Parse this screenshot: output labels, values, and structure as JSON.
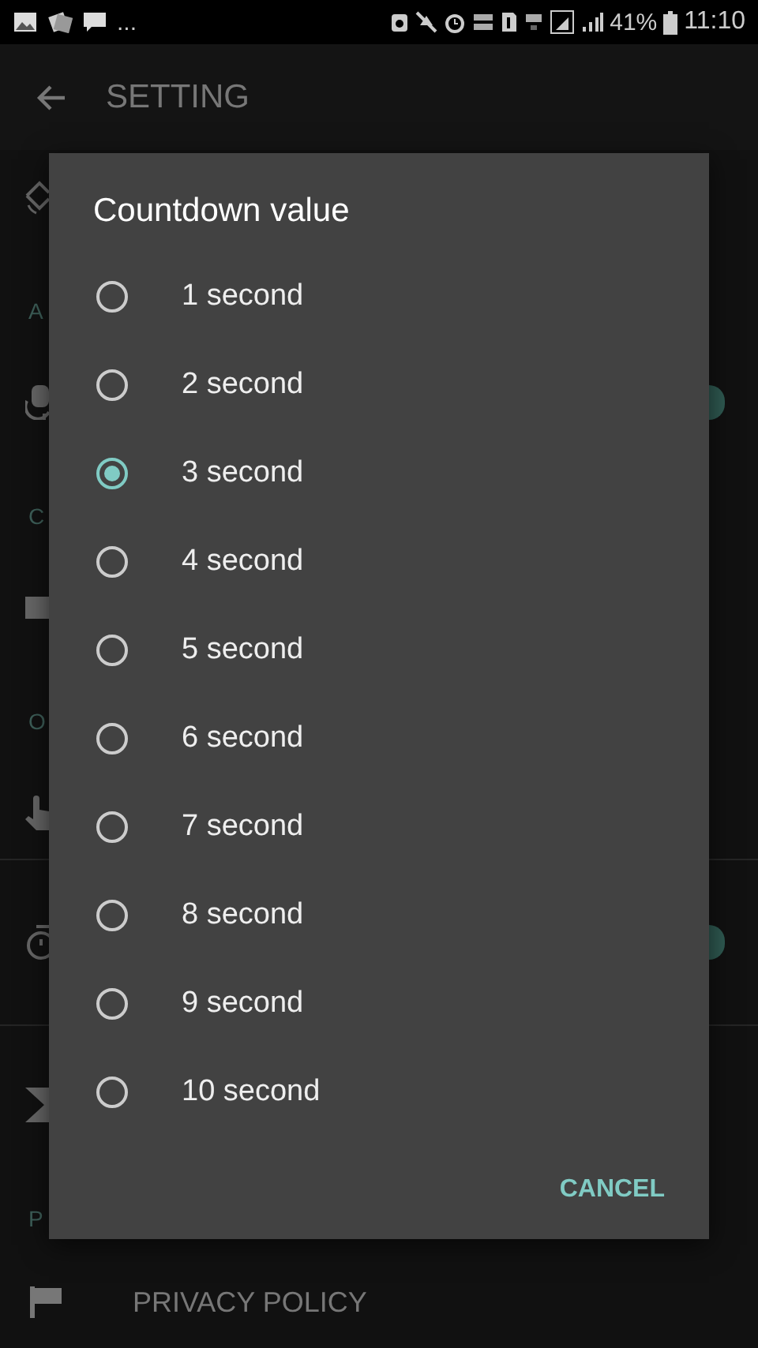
{
  "status_bar": {
    "overflow": "...",
    "battery": "41%",
    "time": "11:10"
  },
  "app_bar": {
    "title": "SETTING"
  },
  "settings": [
    {
      "kind": "row"
    },
    {
      "kind": "header",
      "label": "A"
    },
    {
      "kind": "row",
      "toggle_on": true
    },
    {
      "kind": "header",
      "label": "C"
    },
    {
      "kind": "row"
    },
    {
      "kind": "header",
      "label": "O"
    },
    {
      "kind": "row",
      "divider": true
    },
    {
      "kind": "row",
      "toggle_on": true,
      "divider": true
    },
    {
      "kind": "row"
    },
    {
      "kind": "header",
      "label": "P"
    },
    {
      "kind": "row",
      "label": "PRIVACY POLICY"
    }
  ],
  "dialog": {
    "title": "Countdown value",
    "options": [
      {
        "label": "1 second",
        "selected": false
      },
      {
        "label": "2 second",
        "selected": false
      },
      {
        "label": "3 second",
        "selected": true
      },
      {
        "label": "4 second",
        "selected": false
      },
      {
        "label": "5 second",
        "selected": false
      },
      {
        "label": "6 second",
        "selected": false
      },
      {
        "label": "7 second",
        "selected": false
      },
      {
        "label": "8 second",
        "selected": false
      },
      {
        "label": "9 second",
        "selected": false
      },
      {
        "label": "10 second",
        "selected": false
      }
    ],
    "button": "CANCEL"
  }
}
